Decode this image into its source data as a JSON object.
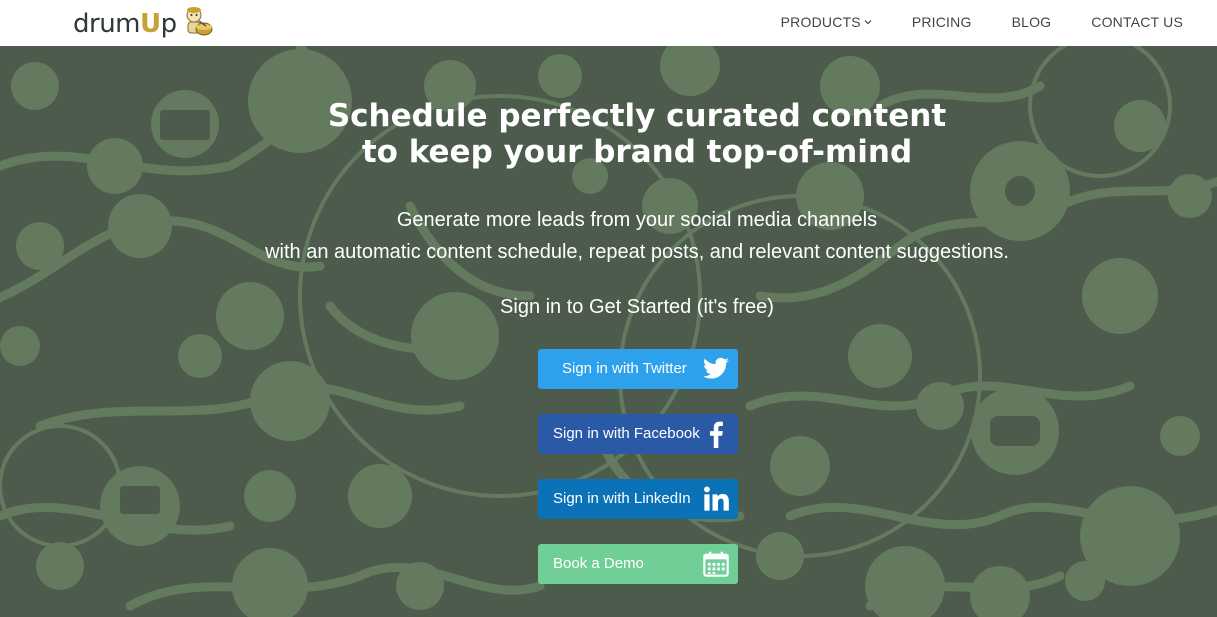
{
  "brand": {
    "logo_text_pre": "drum",
    "logo_text_u": "U",
    "logo_text_post": "p"
  },
  "nav": {
    "items": [
      {
        "label": "PRODUCTS",
        "has_dropdown": true
      },
      {
        "label": "PRICING"
      },
      {
        "label": "BLOG"
      },
      {
        "label": "CONTACT US"
      }
    ]
  },
  "hero": {
    "headline": [
      "Schedule perfectly curated content",
      "to keep your brand top-of-mind"
    ],
    "subheadline": [
      "Generate more leads from your social media channels",
      "with an automatic content schedule, repeat posts, and relevant content suggestions."
    ],
    "cta_label": "Sign in to Get Started (it's free)"
  },
  "buttons": {
    "twitter": {
      "label": "Sign in with Twitter",
      "icon": "twitter-bird-icon",
      "color": "#2ea1ec"
    },
    "facebook": {
      "label": "Sign in with Facebook",
      "icon": "facebook-f-icon",
      "color": "#2a5aa6"
    },
    "linkedin": {
      "label": "Sign in with LinkedIn",
      "icon": "linkedin-in-icon",
      "color": "#0b72b8"
    },
    "demo": {
      "label": "Book a Demo",
      "icon": "calendar-icon",
      "color": "#6fcf97"
    }
  },
  "colors": {
    "hero_bg": "#4c5b4b",
    "pattern": "#637a5f",
    "nav_bg": "#ffffff",
    "logo_accent": "#c8a134"
  }
}
